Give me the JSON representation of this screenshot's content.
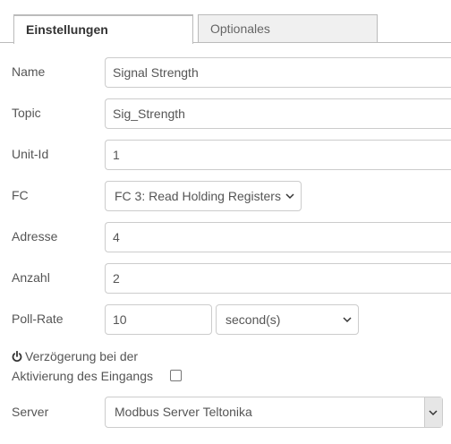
{
  "tabs": [
    {
      "label": "Einstellungen",
      "active": true
    },
    {
      "label": "Optionales",
      "active": false
    }
  ],
  "form": {
    "name": {
      "label": "Name",
      "value": "Signal Strength"
    },
    "topic": {
      "label": "Topic",
      "value": "Sig_Strength"
    },
    "unit_id": {
      "label": "Unit-Id",
      "value": "1"
    },
    "fc": {
      "label": "FC",
      "selected": "FC 3: Read Holding Registers"
    },
    "adresse": {
      "label": "Adresse",
      "value": "4"
    },
    "anzahl": {
      "label": "Anzahl",
      "value": "2"
    },
    "poll_rate": {
      "label": "Poll-Rate",
      "value": "10",
      "unit_selected": "second(s)"
    },
    "delay": {
      "label_line1": "Verzögerung bei der",
      "label_line2": "Aktivierung des Eingangs",
      "checked": false
    },
    "server": {
      "label": "Server",
      "selected": "Modbus Server Teltonika"
    }
  },
  "icons": {
    "delay_icon": "power-icon",
    "select_icon": "chevron-down-icon"
  },
  "colors": {
    "border": "#cccccc",
    "text": "#555555",
    "inactive_tab_bg": "#f0f0f0"
  }
}
